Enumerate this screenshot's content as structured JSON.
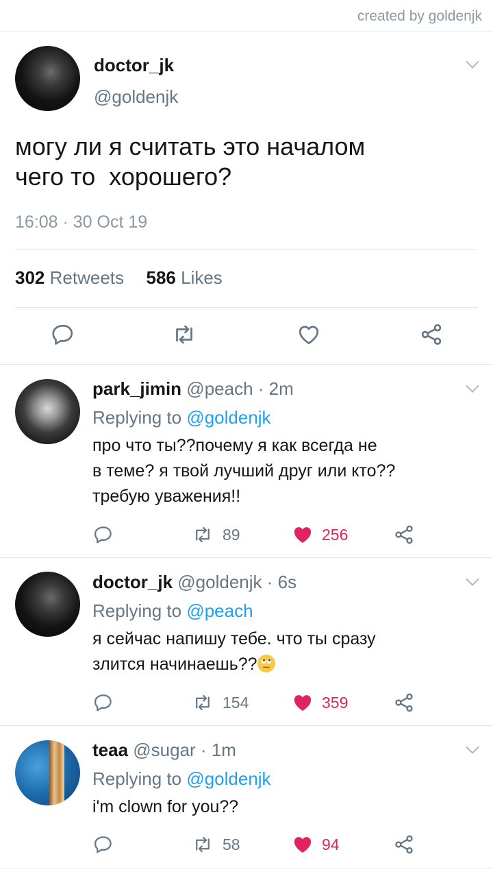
{
  "credit": "created by goldenjk",
  "main_tweet": {
    "name": "doctor_jk",
    "handle": "@goldenjk",
    "text": "могу ли я считать это началом\nчего то  хорошего?",
    "timestamp": "16:08 · 30 Oct 19",
    "retweets_count": "302",
    "retweets_label": "Retweets",
    "likes_count": "586",
    "likes_label": "Likes"
  },
  "replies": [
    {
      "name": "park_jimin",
      "meta": "@peach · 2m",
      "replying_label": "Replying to",
      "replying_to": "@goldenjk",
      "text": "про что ты??почему я как всегда не\nв теме? я твой лучший друг или кто??\nтребую уважения!!",
      "retweets": "89",
      "likes": "256",
      "liked": true
    },
    {
      "name": "doctor_jk",
      "meta": "@goldenjk · 6s",
      "replying_label": "Replying to",
      "replying_to": "@peach",
      "text": "я сейчас напишу тебе. что ты сразу\nзлится начинаешь??",
      "retweets": "154",
      "likes": "359",
      "liked": true,
      "emoji": "face-with-rolling-eyes"
    },
    {
      "name": "teaa",
      "meta": "@sugar · 1m",
      "replying_label": "Replying to",
      "replying_to": "@goldenjk",
      "text": "i'm clown for you??",
      "retweets": "58",
      "likes": "94",
      "liked": true
    }
  ],
  "icons": {
    "reply": "reply-icon",
    "retweet": "retweet-icon",
    "like": "heart-icon",
    "share": "share-icon",
    "menu": "chevron-down-icon"
  },
  "colors": {
    "accent": "#1da1f2",
    "liked": "#e0245e",
    "muted": "#657786",
    "divider": "#e1e8ed"
  }
}
